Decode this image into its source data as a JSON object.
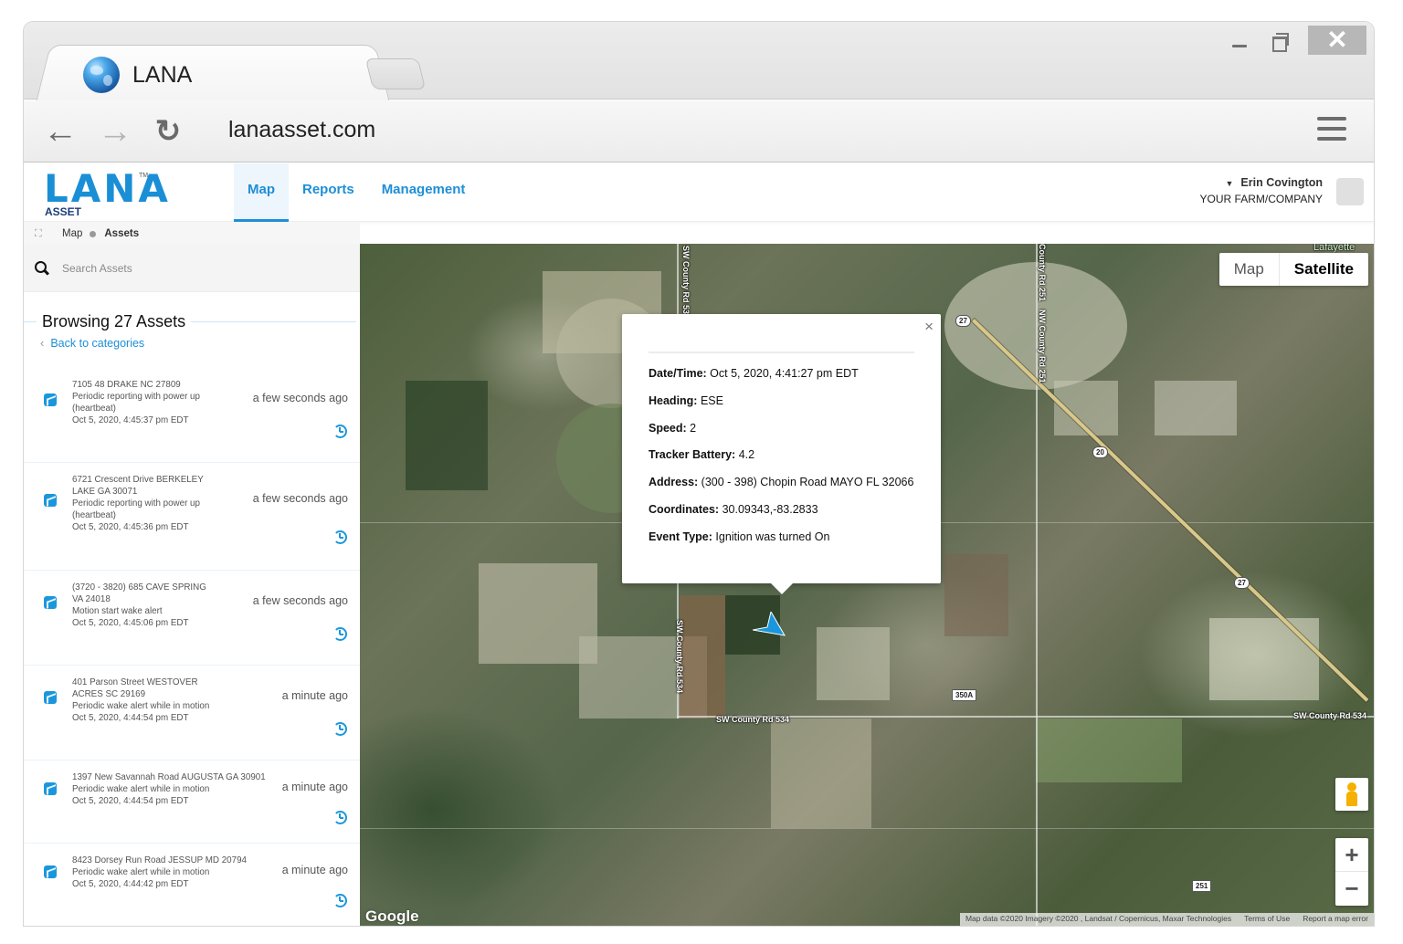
{
  "browser": {
    "tab_title": "LANA",
    "url": "lanaasset.com",
    "close_label": "✕"
  },
  "app": {
    "logo_text": "LANA",
    "logo_sub": "ASSET",
    "logo_tm": "TM",
    "nav": [
      {
        "label": "Map",
        "active": true
      },
      {
        "label": "Reports",
        "active": false
      },
      {
        "label": "Management",
        "active": false
      }
    ],
    "user": {
      "name": "Erin Covington",
      "company": "YOUR FARM/COMPANY"
    },
    "breadcrumb": [
      "Map",
      "Assets"
    ]
  },
  "sidebar": {
    "search_placeholder": "Search Assets",
    "search_value": "",
    "title": "Browsing 27 Assets",
    "back_label": "Back to categories",
    "assets": [
      {
        "address": "7105 48 DRAKE NC 27809",
        "event": "Periodic reporting with power up (heartbeat)",
        "datetime": "Oct 5, 2020, 4:45:37 pm EDT",
        "ago": "a few seconds ago"
      },
      {
        "address": "6721 Crescent Drive BERKELEY LAKE GA 30071",
        "event": "Periodic reporting with power up (heartbeat)",
        "datetime": "Oct 5, 2020, 4:45:36 pm EDT",
        "ago": "a few seconds ago"
      },
      {
        "address": "(3720 - 3820) 685 CAVE SPRING VA 24018",
        "event": "Motion start wake alert",
        "datetime": "Oct 5, 2020, 4:45:06 pm EDT",
        "ago": "a few seconds ago"
      },
      {
        "address": "401 Parson Street WESTOVER ACRES SC 29169",
        "event": "Periodic wake alert while in motion",
        "datetime": "Oct 5, 2020, 4:44:54 pm EDT",
        "ago": "a minute ago"
      },
      {
        "address": "1397 New Savannah Road AUGUSTA GA 30901",
        "event": "Periodic wake alert while in motion",
        "datetime": "Oct 5, 2020, 4:44:54 pm EDT",
        "ago": "a minute ago"
      },
      {
        "address": "8423 Dorsey Run Road JESSUP MD 20794",
        "event": "Periodic wake alert while in motion",
        "datetime": "Oct 5, 2020, 4:44:42 pm EDT",
        "ago": "a minute ago"
      }
    ]
  },
  "map": {
    "type_options": [
      "Map",
      "Satellite"
    ],
    "type_selected": "Satellite",
    "zoom_in": "+",
    "zoom_out": "−",
    "google_label": "Google",
    "attribution": [
      "Map data ©2020 Imagery ©2020 , Landsat / Copernicus, Maxar Technologies",
      "Terms of Use",
      "Report a map error"
    ],
    "place_label": "Lafayette",
    "road_labels": [
      "SW County Rd 534",
      "SW County Rd 534",
      "SW County Rd 534",
      "SW County Rd 534",
      "NW County Rd 251",
      "County Rd 251"
    ],
    "shields": [
      "27",
      "20",
      "27",
      "350A",
      "251"
    ],
    "popup": {
      "close": "×",
      "rows": [
        {
          "label": "Date/Time:",
          "value": "Oct 5, 2020, 4:41:27 pm EDT"
        },
        {
          "label": "Heading:",
          "value": "ESE"
        },
        {
          "label": "Speed:",
          "value": "2"
        },
        {
          "label": "Tracker Battery:",
          "value": "4.2"
        },
        {
          "label": "Address:",
          "value": "(300 - 398) Chopin Road MAYO FL 32066"
        },
        {
          "label": "Coordinates:",
          "value": "30.09343,-83.2833"
        },
        {
          "label": "Event Type:",
          "value": "Ignition was turned On"
        }
      ]
    }
  },
  "colors": {
    "accent": "#1d8fd7",
    "marker": "#1a97dc"
  }
}
